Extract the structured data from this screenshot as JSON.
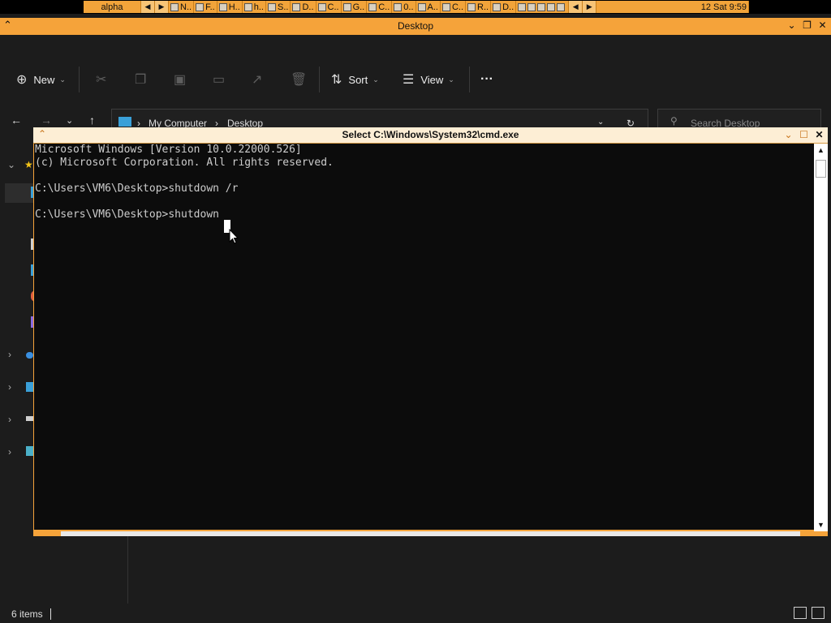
{
  "taskbar": {
    "label": "alpha",
    "items": [
      "N..",
      "F..",
      "H..",
      "h..",
      "S..",
      "D..",
      "C..",
      "G..",
      "C..",
      "0..",
      "A..",
      "C..",
      "R..",
      "D.."
    ],
    "clock": "12 Sat 9:59"
  },
  "explorer": {
    "title": "Desktop",
    "toolbar": {
      "new_label": "New",
      "sort_label": "Sort",
      "view_label": "View",
      "more_label": "···"
    },
    "breadcrumb": [
      "My Computer",
      "Desktop"
    ],
    "search_placeholder": "Search Desktop",
    "status_items": "6 items"
  },
  "cmd": {
    "title": "Select C:\\Windows\\System32\\cmd.exe",
    "lines": [
      "Microsoft Windows [Version 10.0.22000.526]",
      "(c) Microsoft Corporation. All rights reserved.",
      "",
      "C:\\Users\\VM6\\Desktop>shutdown /r",
      "",
      "C:\\Users\\VM6\\Desktop>shutdown"
    ]
  },
  "colors": {
    "accent": "#f5a33a",
    "console_bg": "#0c0c0c",
    "console_fg": "#cccccc"
  }
}
